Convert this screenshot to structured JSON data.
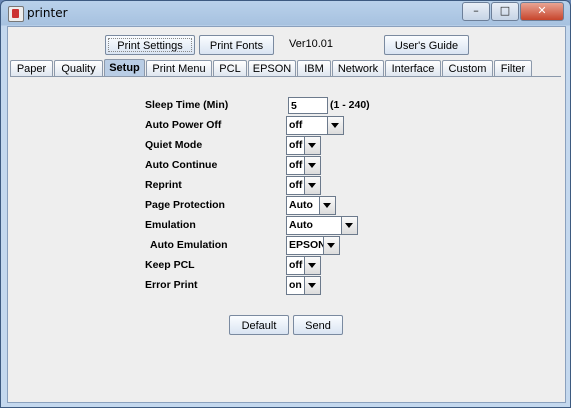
{
  "window": {
    "title": "printer",
    "controls": {
      "minimize": "–",
      "maximize": "□",
      "close": "✕"
    }
  },
  "toolbar": {
    "print_settings": "Print Settings",
    "print_fonts": "Print Fonts",
    "version": "Ver10.01",
    "users_guide": "User's Guide"
  },
  "tabs": [
    "Paper",
    "Quality",
    "Setup",
    "Print Menu",
    "PCL",
    "EPSON",
    "IBM",
    "Network",
    "Interface",
    "Custom",
    "Filter"
  ],
  "active_tab": "Setup",
  "setup": {
    "sleep_time": {
      "label": "Sleep Time (Min)",
      "value": "5",
      "range": "(1  -  240)"
    },
    "auto_power_off": {
      "label": "Auto Power Off",
      "value": "off"
    },
    "quiet_mode": {
      "label": "Quiet Mode",
      "value": "off"
    },
    "auto_continue": {
      "label": "Auto Continue",
      "value": "off"
    },
    "reprint": {
      "label": "Reprint",
      "value": "off"
    },
    "page_protection": {
      "label": "Page Protection",
      "value": "Auto"
    },
    "emulation": {
      "label": "Emulation",
      "value": "Auto"
    },
    "auto_emulation": {
      "label": "Auto Emulation",
      "value": "EPSON"
    },
    "keep_pcl": {
      "label": "Keep PCL",
      "value": "off"
    },
    "error_print": {
      "label": "Error Print",
      "value": "on"
    }
  },
  "actions": {
    "default": "Default",
    "send": "Send"
  }
}
